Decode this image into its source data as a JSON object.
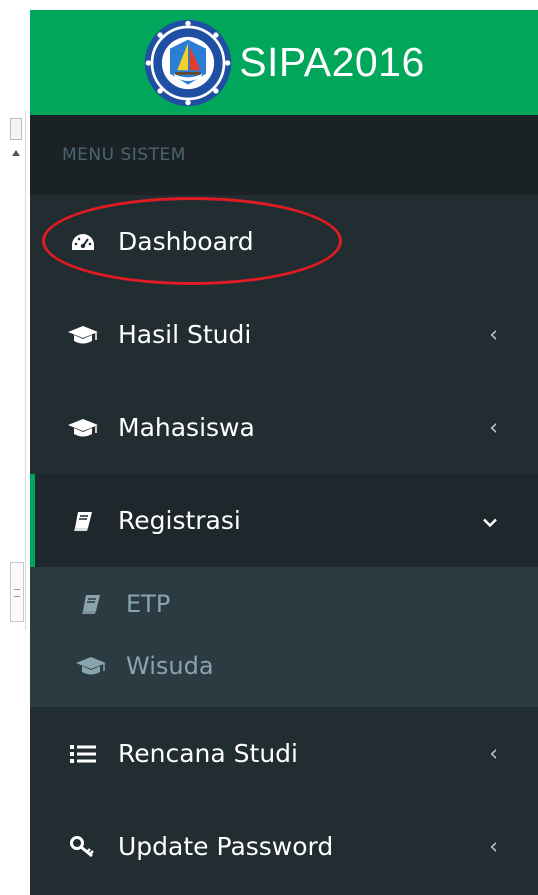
{
  "brand": {
    "title": "SIPA2016"
  },
  "menu": {
    "header": "MENU SISTEM",
    "items": [
      {
        "label": "Dashboard",
        "icon": "dashboard-icon",
        "chevron": ""
      },
      {
        "label": "Hasil Studi",
        "icon": "graduation-cap-icon",
        "chevron": "‹"
      },
      {
        "label": "Mahasiswa",
        "icon": "graduation-cap-icon",
        "chevron": "‹"
      },
      {
        "label": "Registrasi",
        "icon": "book-icon",
        "chevron": "⌄",
        "active": true,
        "subitems": [
          {
            "label": "ETP",
            "icon": "book-icon"
          },
          {
            "label": "Wisuda",
            "icon": "graduation-cap-icon"
          }
        ]
      },
      {
        "label": "Rencana Studi",
        "icon": "list-icon",
        "chevron": "‹"
      },
      {
        "label": "Update Password",
        "icon": "key-icon",
        "chevron": "‹"
      }
    ]
  },
  "colors": {
    "brand_green": "#00a65a",
    "sidebar_bg": "#222d32",
    "header_bg": "#1a2226",
    "submenu_bg": "#2c3b41",
    "highlight_red": "#e11b22"
  }
}
